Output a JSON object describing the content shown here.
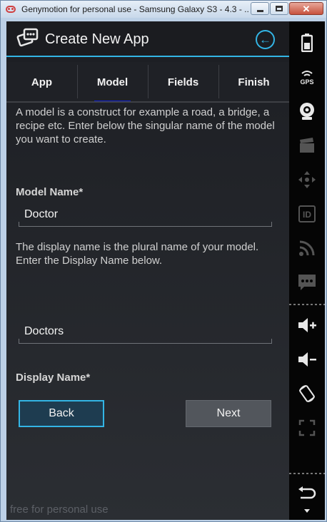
{
  "window": {
    "title": "Genymotion for personal use - Samsung Galaxy S3 - 4.3 - ...",
    "minimize_label": "minimize",
    "maximize_label": "maximize",
    "close_glyph": "✕"
  },
  "actionbar": {
    "title": "Create New App",
    "back_glyph": "←"
  },
  "tabs": [
    {
      "label": "App",
      "active": false
    },
    {
      "label": "Model",
      "active": true
    },
    {
      "label": "Fields",
      "active": false
    },
    {
      "label": "Finish",
      "active": false
    }
  ],
  "form": {
    "model_description": "A model is a construct for example a road, a bridge, a recipe etc. Enter below the singular name of the model you want to create.",
    "model_name_label": "Model Name*",
    "model_name_value": "Doctor",
    "display_description": "The display name is the plural name of your model. Enter the Display Name below.",
    "display_name_label": "Display Name*",
    "display_name_value": "Doctors"
  },
  "buttons": {
    "back_label": "Back",
    "next_label": "Next"
  },
  "watermark": "free for personal use",
  "sidebar": {
    "gps_label": "GPS",
    "id_label": "ID",
    "icons": [
      "battery-icon",
      "gps-icon",
      "webcam-icon",
      "clapperboard-icon",
      "dpad-icon",
      "id-icon",
      "rss-icon",
      "sms-icon",
      "volume-up-icon",
      "volume-down-icon",
      "rotate-icon",
      "fullscreen-icon",
      "back-arrow-icon",
      "menu-caret-icon"
    ]
  },
  "colors": {
    "accent": "#33b5e5",
    "tab_indicator": "#0f1fd4",
    "background": "#1d1f24"
  }
}
